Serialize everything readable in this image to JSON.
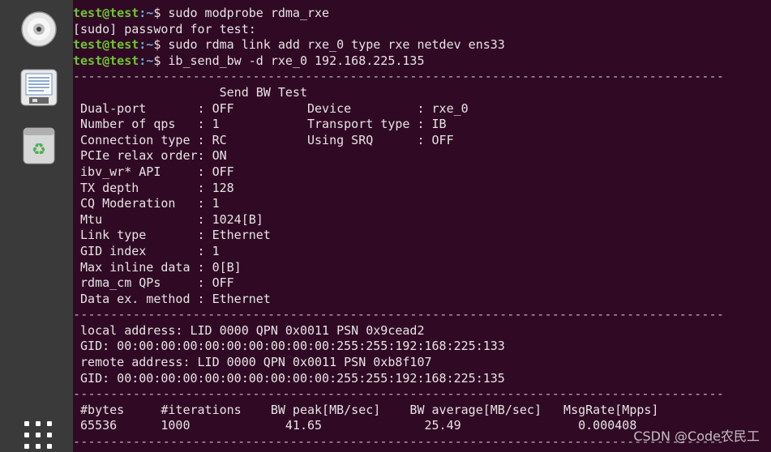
{
  "dock": {
    "items": [
      {
        "name": "cd-drive-icon"
      },
      {
        "name": "text-editor-icon"
      },
      {
        "name": "trash-icon"
      }
    ],
    "apps_grid": "show-applications-icon"
  },
  "terminal": {
    "prompt_user": "test@test",
    "prompt_path": ":~",
    "prompt_symbol": "$",
    "cmd1": " sudo modprobe rdma_rxe",
    "sudo_prompt": "[sudo] password for test:",
    "cmd2": " sudo rdma link add rxe_0 type rxe netdev ens33",
    "cmd3": " ib_send_bw -d rxe_0 192.168.225.135",
    "dash_line": "---------------------------------------------------------------------------------------",
    "title": "                    Send BW Test",
    "params": [
      " Dual-port       : OFF          Device         : rxe_0",
      " Number of qps   : 1            Transport type : IB",
      " Connection type : RC           Using SRQ      : OFF",
      " PCIe relax order: ON",
      " ibv_wr* API     : OFF",
      " TX depth        : 128",
      " CQ Moderation   : 1",
      " Mtu             : 1024[B]",
      " Link type       : Ethernet",
      " GID index       : 1",
      " Max inline data : 0[B]",
      " rdma_cm QPs     : OFF",
      " Data ex. method : Ethernet"
    ],
    "addresses": [
      " local address: LID 0000 QPN 0x0011 PSN 0x9cead2",
      " GID: 00:00:00:00:00:00:00:00:00:00:255:255:192:168:225:133",
      " remote address: LID 0000 QPN 0x0011 PSN 0xb8f107",
      " GID: 00:00:00:00:00:00:00:00:00:00:255:255:192:168:225:135"
    ],
    "results_header": " #bytes     #iterations    BW peak[MB/sec]    BW average[MB/sec]   MsgRate[Mpps]",
    "results_row": " 65536      1000             41.65              25.49                0.000408",
    "last_dash": "---------------------------------------------------------------------------------------"
  },
  "watermark": "CSDN @Code农民工"
}
